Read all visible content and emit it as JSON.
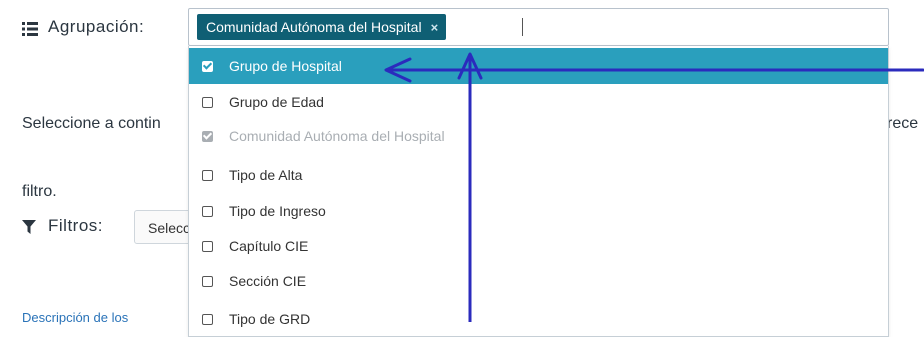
{
  "agrupacion": {
    "label": "Agrupación:"
  },
  "chip": {
    "label": "Comunidad Autónoma del Hospital",
    "remove": "×"
  },
  "intro": {
    "line1_start": "Seleccione a contin",
    "line1_end": "rece",
    "line2": "filtro."
  },
  "filtros": {
    "label": "Filtros:",
    "select_value": "Selecc"
  },
  "desc_link": "Descripción de los",
  "dropdown": {
    "options": [
      {
        "label": "Grupo de Hospital",
        "state": "checked-highlighted"
      },
      {
        "label": "Grupo de Edad",
        "state": "unchecked"
      },
      {
        "label": "Comunidad Autónoma del Hospital",
        "state": "checked-disabled"
      },
      {
        "label": "Tipo de Alta",
        "state": "unchecked"
      },
      {
        "label": "Tipo de Ingreso",
        "state": "unchecked"
      },
      {
        "label": "Capítulo CIE",
        "state": "unchecked"
      },
      {
        "label": "Sección CIE",
        "state": "unchecked"
      },
      {
        "label": "Tipo de GRD",
        "state": "unchecked"
      }
    ]
  },
  "icons": {
    "agrupacion": "list-icon",
    "filtros": "filter-icon",
    "chip_remove": "close-icon"
  },
  "colors": {
    "chip": "#0f5f74",
    "highlight": "#2a9fbd",
    "annotation": "#2b2bbd"
  }
}
